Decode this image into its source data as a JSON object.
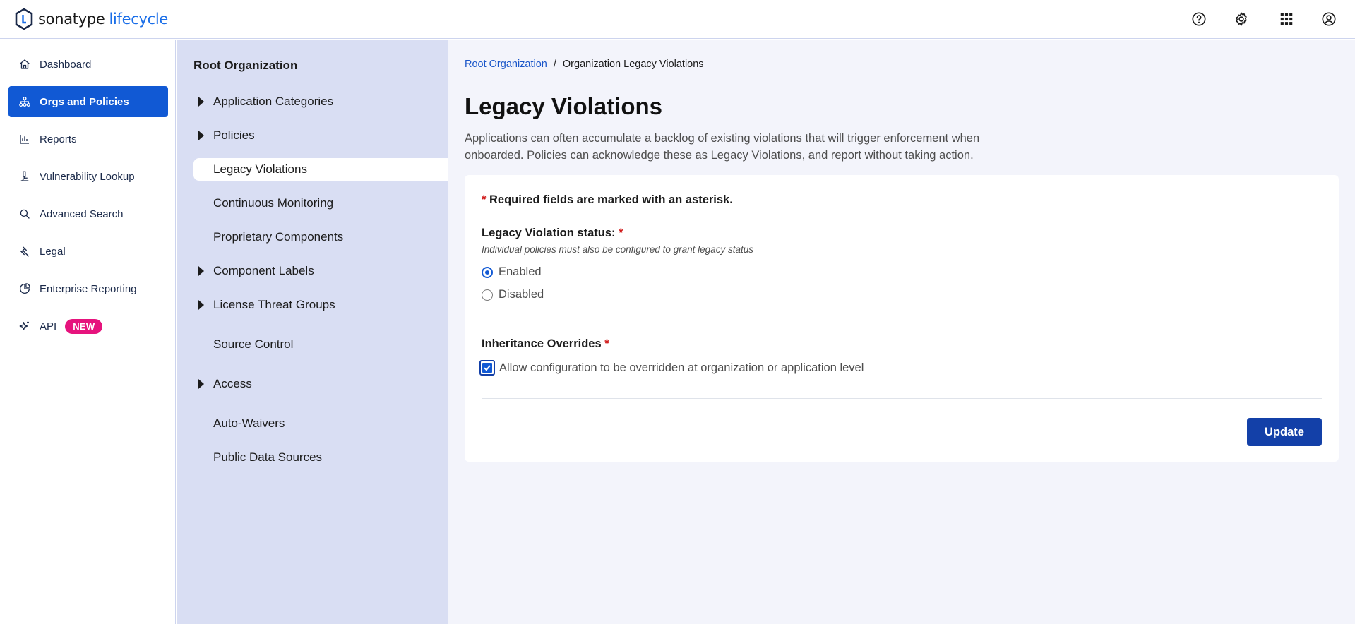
{
  "header": {
    "brand": "sonatype",
    "product": "lifecycle",
    "icons": [
      "help-icon",
      "settings-icon",
      "apps-grid-icon",
      "user-account-icon"
    ]
  },
  "leftnav": {
    "items": [
      {
        "label": "Dashboard",
        "icon": "home-icon"
      },
      {
        "label": "Orgs and Policies",
        "icon": "org-tree-icon",
        "active": true
      },
      {
        "label": "Reports",
        "icon": "chart-icon"
      },
      {
        "label": "Vulnerability Lookup",
        "icon": "microscope-icon"
      },
      {
        "label": "Advanced Search",
        "icon": "search-icon"
      },
      {
        "label": "Legal",
        "icon": "gavel-icon"
      },
      {
        "label": "Enterprise Reporting",
        "icon": "pie-chart-icon"
      },
      {
        "label": "API",
        "icon": "sparkle-icon",
        "badge": "NEW"
      }
    ]
  },
  "subnav": {
    "title": "Root Organization",
    "items": [
      {
        "label": "Application Categories",
        "expandable": true
      },
      {
        "label": "Policies",
        "expandable": true
      },
      {
        "label": "Legacy Violations",
        "expandable": false,
        "active": true
      },
      {
        "label": "Continuous Monitoring",
        "expandable": false
      },
      {
        "label": "Proprietary Components",
        "expandable": false
      },
      {
        "label": "Component Labels",
        "expandable": true
      },
      {
        "label": "License Threat Groups",
        "expandable": true
      },
      {
        "label": "Source Control",
        "expandable": false
      },
      {
        "label": "Access",
        "expandable": true
      },
      {
        "label": "Auto-Waivers",
        "expandable": false
      },
      {
        "label": "Public Data Sources",
        "expandable": false
      }
    ]
  },
  "main": {
    "breadcrumb": {
      "link": "Root Organization",
      "separator": "/",
      "current": "Organization Legacy Violations"
    },
    "title": "Legacy Violations",
    "description": "Applications can often accumulate a backlog of existing violations that will trigger enforcement when onboarded. Policies can acknowledge these as Legacy Violations, and report without taking action.",
    "form": {
      "required_asterisk": "*",
      "required_note": "Required fields are marked with an asterisk.",
      "status_label": "Legacy Violation status:",
      "status_hint": "Individual policies must also be configured to grant legacy status",
      "options": [
        {
          "label": "Enabled",
          "selected": true
        },
        {
          "label": "Disabled",
          "selected": false
        }
      ],
      "inheritance_label": "Inheritance Overrides",
      "inheritance_checkbox_label": "Allow configuration to be overridden at organization or application level",
      "inheritance_checked": true,
      "update_label": "Update"
    }
  },
  "colors": {
    "accent": "#1159d4",
    "button": "#1340a8",
    "subnav_bg": "#d9def3",
    "main_bg": "#f3f4fb",
    "badge": "#e6137d",
    "required": "#d01818"
  }
}
